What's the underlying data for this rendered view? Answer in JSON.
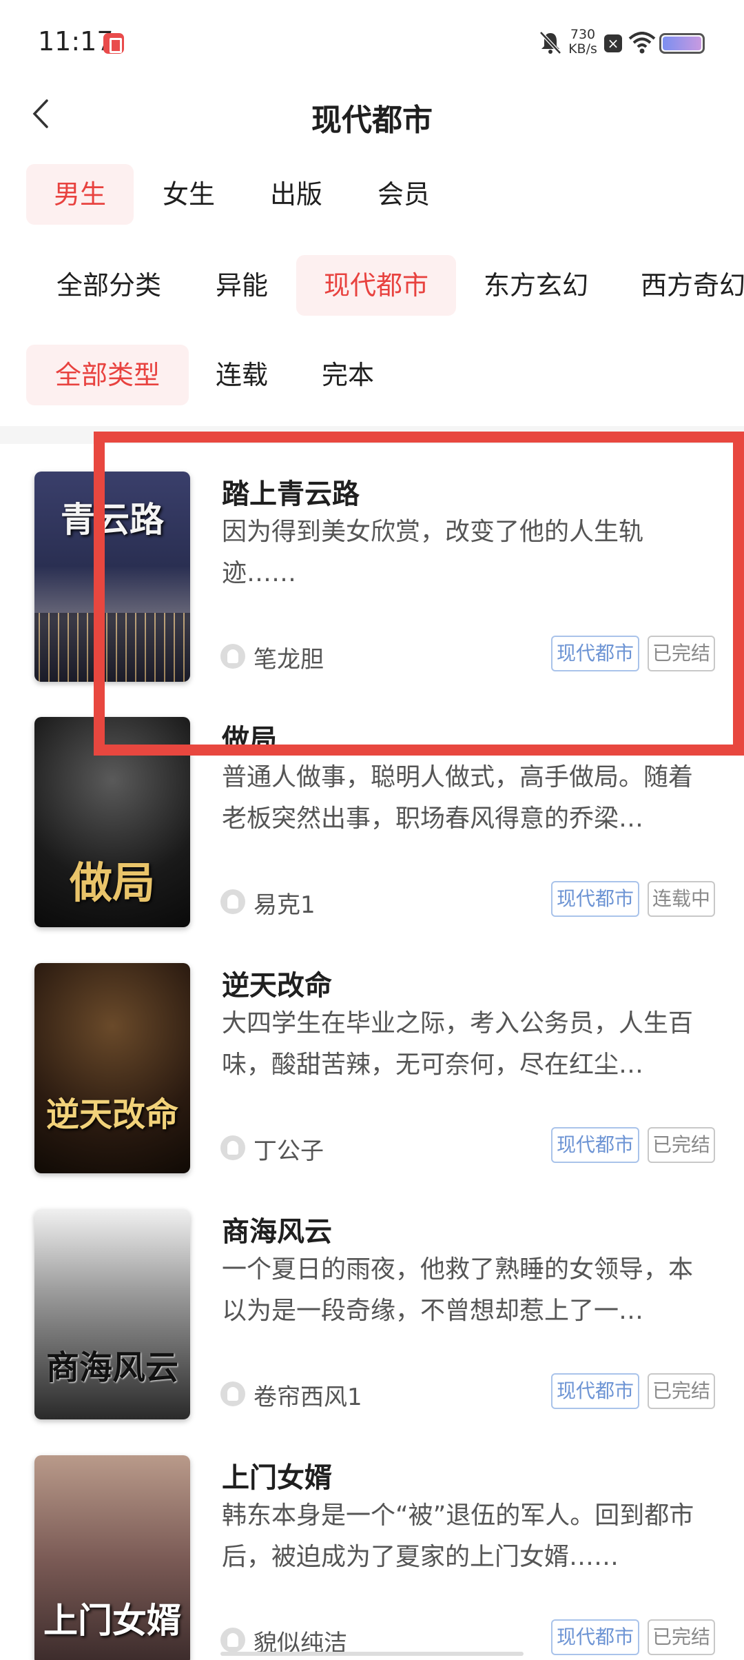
{
  "status_bar": {
    "time": "11:17",
    "net_speed_value": "730",
    "net_speed_unit": "KB/s"
  },
  "header": {
    "title": "现代都市"
  },
  "gender_tabs": [
    {
      "label": "男生",
      "active": true
    },
    {
      "label": "女生",
      "active": false
    },
    {
      "label": "出版",
      "active": false
    },
    {
      "label": "会员",
      "active": false
    }
  ],
  "category_tabs": [
    {
      "label": "全部分类",
      "active": false
    },
    {
      "label": "异能",
      "active": false
    },
    {
      "label": "现代都市",
      "active": true
    },
    {
      "label": "东方玄幻",
      "active": false
    },
    {
      "label": "西方奇幻",
      "active": false
    }
  ],
  "status_tabs": [
    {
      "label": "全部类型",
      "active": true
    },
    {
      "label": "连载",
      "active": false
    },
    {
      "label": "完本",
      "active": false
    }
  ],
  "books": [
    {
      "title": "踏上青云路",
      "desc": "因为得到美女欣赏，改变了他的人生轨迹……",
      "author": "笔龙胆",
      "genre": "现代都市",
      "status": "已完结",
      "cover_text": "青云路"
    },
    {
      "title": "做局",
      "desc": "普通人做事，聪明人做式，高手做局。随着老板突然出事，职场春风得意的乔梁…",
      "author": "易克1",
      "genre": "现代都市",
      "status": "连载中",
      "cover_text": "做局"
    },
    {
      "title": "逆天改命",
      "desc": "大四学生在毕业之际，考入公务员，人生百味，酸甜苦辣，无可奈何，尽在红尘…",
      "author": "丁公子",
      "genre": "现代都市",
      "status": "已完结",
      "cover_text": "逆天改命"
    },
    {
      "title": "商海风云",
      "desc": "一个夏日的雨夜，他救了熟睡的女领导，本以为是一段奇缘，不曾想却惹上了一…",
      "author": "卷帘西风1",
      "genre": "现代都市",
      "status": "已完结",
      "cover_text": "商海风云"
    },
    {
      "title": "上门女婿",
      "desc": "韩东本身是一个“被”退伍的军人。回到都市后，被迫成为了夏家的上门女婿……",
      "author": "貌似纯洁",
      "genre": "现代都市",
      "status": "已完结",
      "cover_text": "上门女婿"
    }
  ],
  "colors": {
    "accent": "#e8423f",
    "active_bg": "#fdf0f0",
    "genre_tag": "#6d94d4",
    "highlight": "#e8473f"
  }
}
